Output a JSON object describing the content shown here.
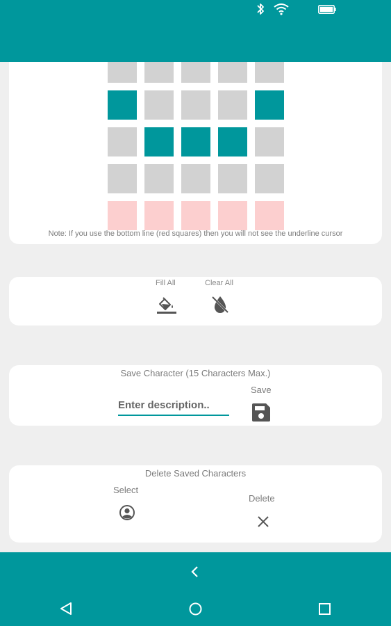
{
  "colors": {
    "accent": "#00979c",
    "cell_off": "#d2d2d2",
    "cell_red": "#fccfcf",
    "card": "#ffffff",
    "background": "#efefef"
  },
  "status_bar": {
    "icons": [
      "bluetooth-icon",
      "wifi-icon",
      "battery-icon"
    ]
  },
  "grid": {
    "rows": [
      [
        "off",
        "off",
        "off",
        "off",
        "off"
      ],
      [
        "on",
        "off",
        "off",
        "off",
        "on"
      ],
      [
        "off",
        "on",
        "on",
        "on",
        "off"
      ],
      [
        "off",
        "off",
        "off",
        "off",
        "off"
      ],
      [
        "red",
        "red",
        "red",
        "red",
        "red"
      ]
    ],
    "note": "Note: If you use the bottom line (red squares) then you will not see the underline cursor"
  },
  "fill_actions": {
    "fill_all_label": "Fill All",
    "clear_all_label": "Clear All"
  },
  "save_section": {
    "title": "Save Character (15 Characters Max.)",
    "input_placeholder": "Enter description..",
    "input_value": "",
    "save_label": "Save"
  },
  "delete_section": {
    "title": "Delete Saved Characters",
    "select_label": "Select",
    "delete_label": "Delete"
  },
  "nav": {
    "icons": [
      "back-chevron-icon",
      "nav-back-icon",
      "nav-home-icon",
      "nav-recents-icon"
    ]
  }
}
